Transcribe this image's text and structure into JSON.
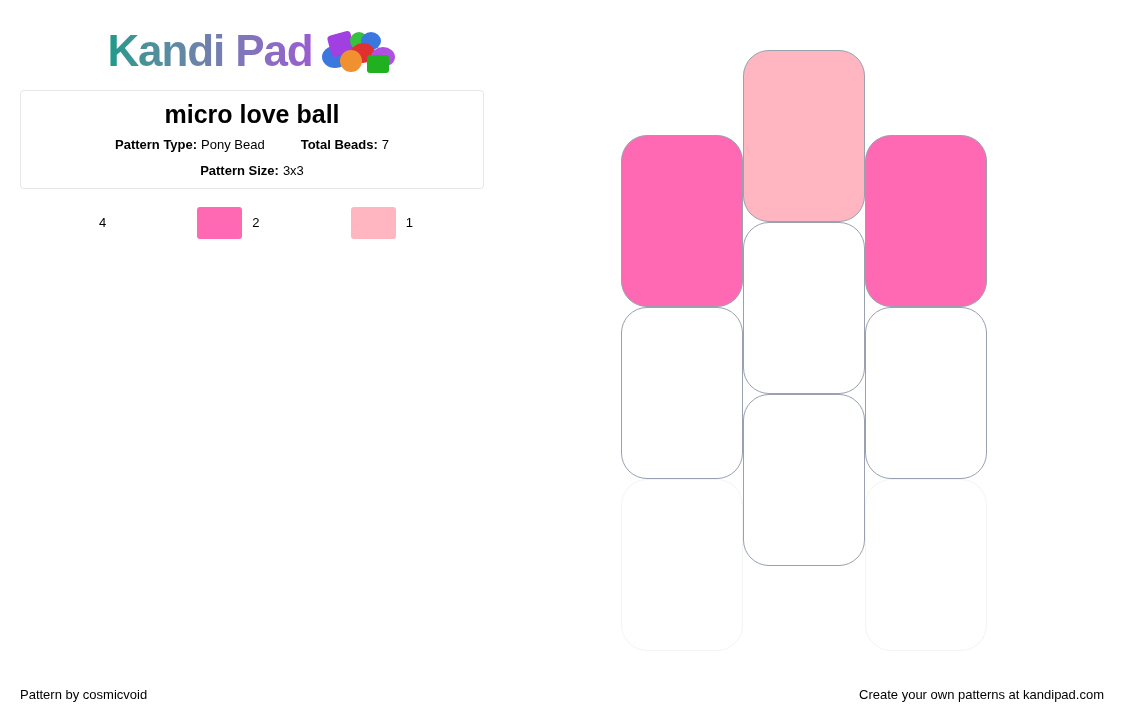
{
  "logo": {
    "text": "Kandi Pad"
  },
  "pattern": {
    "title": "micro love ball",
    "details": [
      {
        "label": "Pattern Type:",
        "value": "Pony Bead"
      },
      {
        "label": "Total Beads:",
        "value": "7"
      },
      {
        "label": "Pattern Size:",
        "value": "3x3"
      }
    ]
  },
  "legend": [
    {
      "count": "4"
    },
    {
      "color": "#ff69b4",
      "count": "2"
    },
    {
      "color": "#ffb6c1",
      "count": "1"
    }
  ],
  "bead_columns": [
    [
      {
        "color": "#ff69b4",
        "faded": false
      },
      {
        "color": "#ffffff",
        "faded": false
      },
      {
        "color": "#ffffff",
        "faded": true
      }
    ],
    [
      {
        "color": "#ffb6c1",
        "faded": false
      },
      {
        "color": "#ffffff",
        "faded": false
      },
      {
        "color": "#ffffff",
        "faded": false
      }
    ],
    [
      {
        "color": "#ff69b4",
        "faded": false
      },
      {
        "color": "#ffffff",
        "faded": false
      },
      {
        "color": "#ffffff",
        "faded": true
      }
    ]
  ],
  "footer": {
    "credit": "Pattern by cosmicvoid",
    "promo": "Create your own patterns at kandipad.com"
  }
}
